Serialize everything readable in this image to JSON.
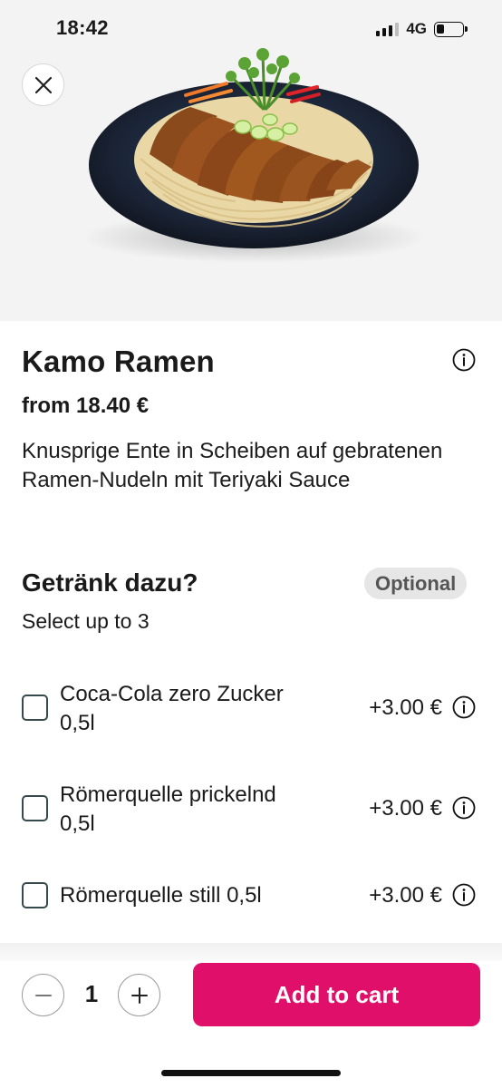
{
  "status": {
    "time": "18:42",
    "network": "4G",
    "battery_level": 0.3
  },
  "hero": {
    "image": "kamo-ramen-bowl-image"
  },
  "product": {
    "title": "Kamo Ramen",
    "price": "from 18.40 €",
    "description": "Knusprige Ente in Scheiben auf gebratenen Ramen-Nudeln mit Teriyaki Sauce"
  },
  "group": {
    "title": "Getränk dazu?",
    "badge": "Optional",
    "subtitle": "Select up to 3",
    "options": [
      {
        "label": "Coca-Cola zero Zucker 0,5l",
        "price": "+3.00 €",
        "checked": false
      },
      {
        "label": "Römerquelle prickelnd 0,5l",
        "price": "+3.00 €",
        "checked": false
      },
      {
        "label": "Römerquelle still 0,5l",
        "price": "+3.00 €",
        "checked": false
      }
    ]
  },
  "cart": {
    "quantity": "1",
    "add_label": "Add to cart"
  },
  "colors": {
    "accent": "#e0106a",
    "badge_bg": "#e6e6e6",
    "checkbox_border": "#36494c"
  },
  "icons": [
    "close-icon",
    "info-icon",
    "minus-icon",
    "plus-icon",
    "signal-icon",
    "battery-icon"
  ]
}
